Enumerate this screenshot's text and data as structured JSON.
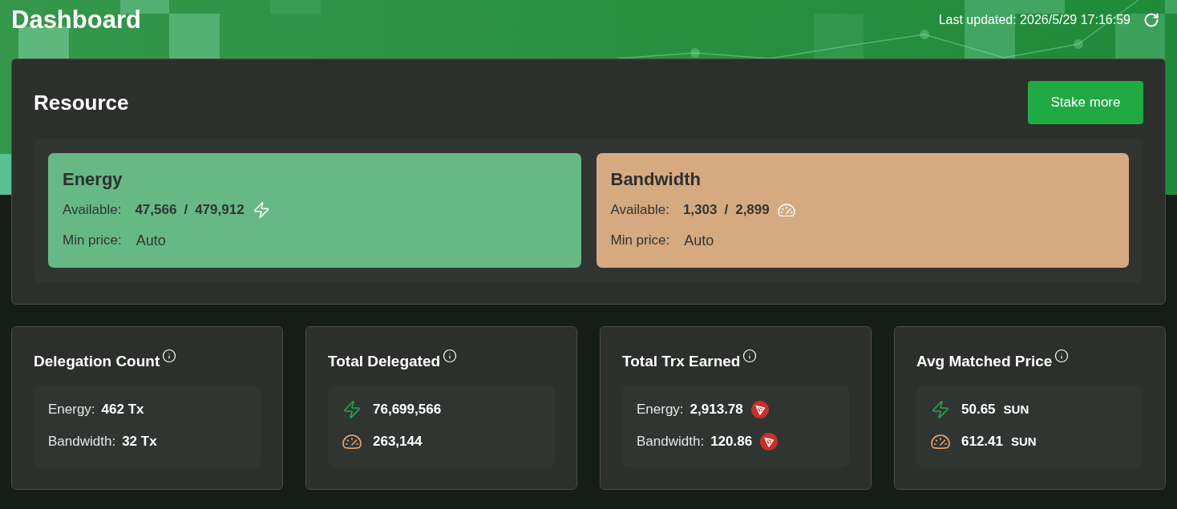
{
  "header": {
    "title": "Dashboard",
    "last_updated": "Last updated: 2026/5/29 17:16:59"
  },
  "resource": {
    "title": "Resource",
    "button": "Stake more",
    "cards": [
      {
        "kind": "energy",
        "color": "#66b985",
        "title": "Energy",
        "available_label": "Available:",
        "available": "47,566",
        "separator": "/",
        "total": "479,912",
        "min_price_label": "Min price:",
        "min_price": "Auto"
      },
      {
        "kind": "bandwidth",
        "color": "#d5aa80",
        "title": "Bandwidth",
        "available_label": "Available:",
        "available": "1,303",
        "separator": "/",
        "total": "2,899",
        "min_price_label": "Min price:",
        "min_price": "Auto"
      }
    ]
  },
  "stats": [
    {
      "title": "Delegation Count",
      "rows": [
        {
          "kind": "labeled",
          "label": "Energy:",
          "value": "462 Tx"
        },
        {
          "kind": "labeled",
          "label": "Bandwidth:",
          "value": "32 Tx"
        }
      ]
    },
    {
      "title": "Total Delegated",
      "rows": [
        {
          "kind": "energy",
          "value": "76,699,566"
        },
        {
          "kind": "bandwidth",
          "value": "263,144"
        }
      ]
    },
    {
      "title": "Total Trx Earned",
      "rows": [
        {
          "kind": "labeled",
          "label": "Energy:",
          "value": "2,913.78",
          "trx_icon": true
        },
        {
          "kind": "labeled",
          "label": "Bandwidth:",
          "value": "120.86",
          "trx_icon": true
        }
      ]
    },
    {
      "title": "Avg Matched Price",
      "rows": [
        {
          "kind": "energy",
          "value": "50.65",
          "unit": "SUN"
        },
        {
          "kind": "bandwidth",
          "value": "612.41",
          "unit": "SUN"
        }
      ]
    }
  ]
}
